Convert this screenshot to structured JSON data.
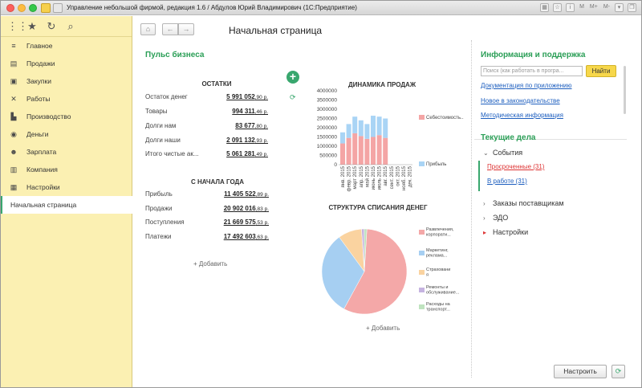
{
  "window": {
    "title": "Управление небольшой фирмой, редакция 1.6 / Абдулов Юрий Владимирович  (1С:Предприятие)",
    "right_tools": [
      "M",
      "M+",
      "M-"
    ]
  },
  "sidebar": {
    "items": [
      {
        "label": "Главное",
        "icon": "menu-lines-icon"
      },
      {
        "label": "Продажи",
        "icon": "sales-register-icon"
      },
      {
        "label": "Закупки",
        "icon": "cart-icon"
      },
      {
        "label": "Работы",
        "icon": "tools-icon"
      },
      {
        "label": "Производство",
        "icon": "factory-icon"
      },
      {
        "label": "Деньги",
        "icon": "money-icon"
      },
      {
        "label": "Зарплата",
        "icon": "people-icon"
      },
      {
        "label": "Компания",
        "icon": "building-icon"
      },
      {
        "label": "Настройки",
        "icon": "settings-icon"
      },
      {
        "label": "Начальная страница",
        "icon": ""
      }
    ]
  },
  "header": {
    "title": "Начальная страница"
  },
  "pulse": {
    "title": "Пульс бизнеса",
    "balances": {
      "title": "ОСТАТКИ",
      "rows": [
        {
          "label": "Остаток денег",
          "value": "5 991 052",
          "unit": ",90 р."
        },
        {
          "label": "Товары",
          "value": "994 311",
          "unit": ",46 р."
        },
        {
          "label": "Долги нам",
          "value": "83 677",
          "unit": ",80 р."
        },
        {
          "label": "Долги наши",
          "value": "2 091 132",
          "unit": ",93 р."
        },
        {
          "label": "Итого чистые ак...",
          "value": "5 061 281",
          "unit": ",49 р."
        }
      ]
    },
    "year": {
      "title": "С НАЧАЛА ГОДА",
      "rows": [
        {
          "label": "Прибыль",
          "value": "11 405 522",
          "unit": ",89 р."
        },
        {
          "label": "Продажи",
          "value": "20 902 016",
          "unit": ",83 р."
        },
        {
          "label": "Поступления",
          "value": "21 669 575",
          "unit": ",53 р."
        },
        {
          "label": "Платежи",
          "value": "17 492 603",
          "unit": ",63 р."
        }
      ]
    },
    "add_label": "+ Добавить",
    "add_label_right": "+ Добавить"
  },
  "chart_data": [
    {
      "type": "bar",
      "title": "ДИНАМИКА ПРОДАЖ",
      "stacked": true,
      "categories": [
        "янв. 2015",
        "февр. 2015",
        "март 2015",
        "апр. 2015",
        "май 2015",
        "июнь 2015",
        "июль 2015",
        "авг. 2015",
        "сент. 2015",
        "окт. 2015",
        "нояб. 2015",
        "дек. 2015"
      ],
      "series": [
        {
          "name": "Себестоимость...",
          "color": "#f4a5a5",
          "values": [
            1150000,
            1450000,
            1700000,
            1550000,
            1400000,
            1500000,
            1600000,
            1450000,
            0,
            0,
            0,
            0
          ]
        },
        {
          "name": "Прибыль",
          "color": "#a9d4f5",
          "values": [
            600000,
            750000,
            900000,
            850000,
            800000,
            1150000,
            1000000,
            1050000,
            0,
            0,
            0,
            0
          ]
        }
      ],
      "ylim": [
        0,
        4000000
      ],
      "yticks": [
        "4000000",
        "3500000",
        "3000000",
        "2500000",
        "2000000",
        "1500000",
        "1000000",
        "500000",
        "0"
      ],
      "legend_position": "right"
    },
    {
      "type": "pie",
      "title": "СТРУКТУРА СПИСАНИЯ ДЕНЕГ",
      "slices": [
        {
          "name": "Развлечения, корпорати...",
          "value": 57,
          "color": "#f4a8a8"
        },
        {
          "name": "Маркетинг, реклама...",
          "value": 32,
          "color": "#a6cff2"
        },
        {
          "name": "Страховани я",
          "value": 9,
          "color": "#fad3a0"
        },
        {
          "name": "Ремонты и обслуживание...",
          "value": 1,
          "color": "#c5b3e0"
        },
        {
          "name": "Расходы на транспорт...",
          "value": 1,
          "color": "#bfe3bf"
        }
      ],
      "legend_position": "right"
    }
  ],
  "support": {
    "title": "Информация и поддержка",
    "search_placeholder": "Поиск (как работать в програ...",
    "find_label": "Найти",
    "links": [
      "Документация по приложению",
      "Новое в законодательстве",
      "Методическая информация"
    ]
  },
  "tasks": {
    "title": "Текущие дела",
    "events_label": "События",
    "overdue": "Просроченные (31)",
    "in_progress": "В работе (31)",
    "items": [
      "Заказы поставщикам",
      "ЭДО",
      "Настройки"
    ]
  },
  "footer": {
    "setup_label": "Настроить"
  }
}
